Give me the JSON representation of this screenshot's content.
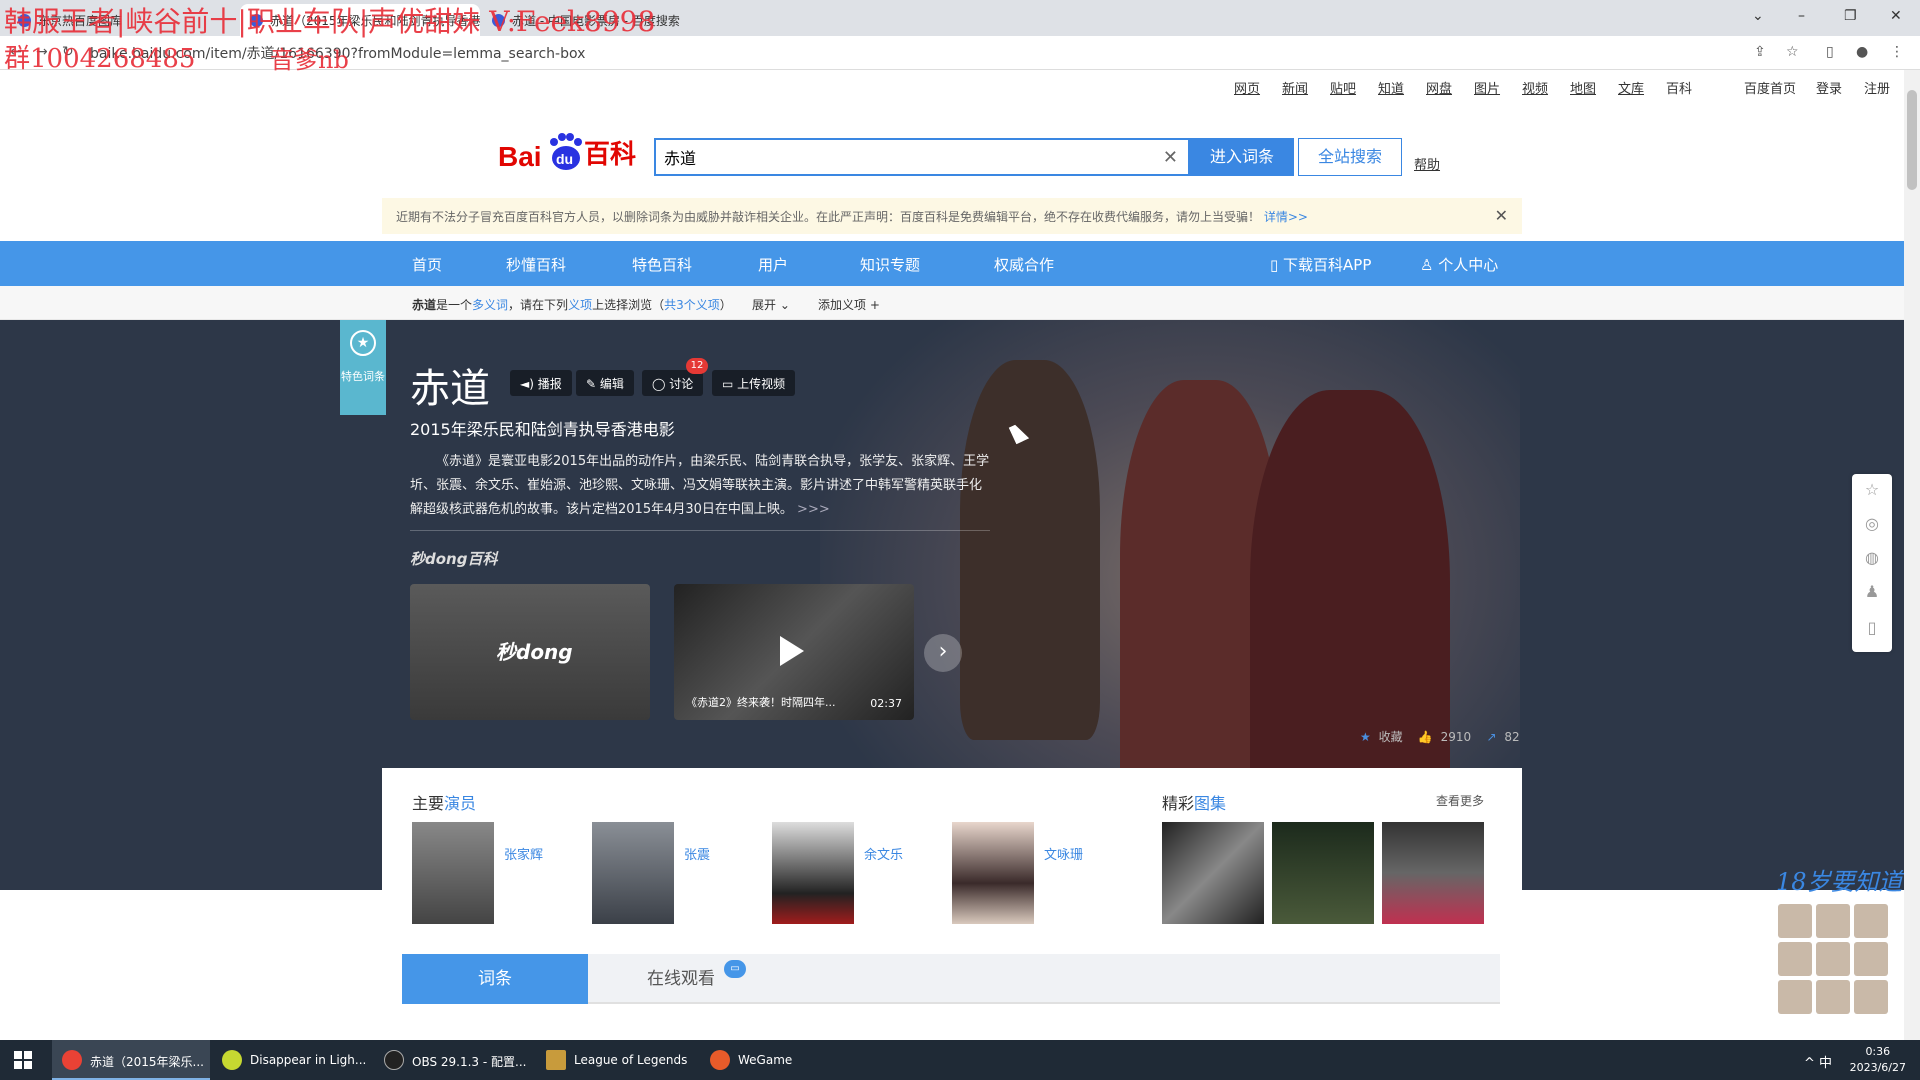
{
  "browser": {
    "tabs": [
      {
        "title": "东京热百度图库"
      },
      {
        "title": "赤道（2015年梁乐民和陆剑青执导香港电影）_百度百科"
      },
      {
        "title": "赤道 - 中国电影票房 - 百度搜索"
      }
    ],
    "url": "baike.baidu.com/item/赤道/16166390?fromModule=lemma_search-box",
    "window_controls": {
      "minimize": "–",
      "restore": "❐",
      "close": "✕",
      "menu": "⌄"
    }
  },
  "overlay": {
    "line1": "韩服王者|峡谷前十|职业车队|声优甜妹 V:Feek8998",
    "line2": "群1004268485",
    "line3": "音爹nb"
  },
  "toplinks": {
    "items": [
      "网页",
      "新闻",
      "贴吧",
      "知道",
      "网盘",
      "图片",
      "视频",
      "地图",
      "文库",
      "百科"
    ],
    "home": "百度首页",
    "login": "登录",
    "register": "注册"
  },
  "logo": {
    "text": "百科"
  },
  "search": {
    "value": "赤道",
    "enter_label": "进入词条",
    "all_label": "全站搜索",
    "help_label": "帮助"
  },
  "notice": {
    "text": "近期有不法分子冒充百度百科官方人员，以删除词条为由威胁并敲诈相关企业。在此严正声明：百度百科是免费编辑平台，绝不存在收费代编服务，请勿上当受骗！",
    "more": "详情>>"
  },
  "nav": {
    "items": [
      "首页",
      "秒懂百科",
      "特色百科",
      "用户",
      "知识专题",
      "权威合作"
    ],
    "download_app": "下载百科APP",
    "personal_center": "个人中心"
  },
  "subbar": {
    "lead": "赤道",
    "text_a": "是一个",
    "polysemy": "多义词",
    "text_b": "，请在下列",
    "meaning": "义项",
    "text_c": "上选择浏览（",
    "count": "共3个义项",
    "text_d": "）",
    "expand": "展开",
    "add": "添加义项"
  },
  "badge": {
    "label": "特色词条"
  },
  "entry": {
    "title": "赤道",
    "actions": {
      "broadcast": "播报",
      "edit": "编辑",
      "discuss": "讨论",
      "upload": "上传视频"
    },
    "discuss_count": "12",
    "subtitle": "2015年梁乐民和陆剑青执导香港电影",
    "summary": "《赤道》是寰亚电影2015年出品的动作片，由梁乐民、陆剑青联合执导，张学友、张家辉、王学圻、张震、余文乐、崔始源、池珍熙、文咏珊、冯文娟等联袂主演。影片讲述了中韩军警精英联手化解超级核武器危机的故事。该片定档2015年4月30日在中国上映。",
    "summary_more": ">>>"
  },
  "miaodong": {
    "logo": "秒dong百科",
    "video1_label": "秒dong",
    "video2_caption": "《赤道2》终来袭！时隔四年...",
    "video2_duration": "02:37"
  },
  "stats": {
    "collect": "收藏",
    "likes": "2910",
    "shares": "82"
  },
  "cast": {
    "title_a": "主要",
    "title_b": "演员",
    "actors": [
      "张家辉",
      "张震",
      "余文乐",
      "文咏珊"
    ]
  },
  "gallery": {
    "title_a": "精彩",
    "title_b": "图集",
    "more": "查看更多"
  },
  "content_tabs": {
    "entry": "词条",
    "watch": "在线观看"
  },
  "promo": {
    "age_text": "18岁要知道"
  },
  "taskbar": {
    "items": [
      {
        "label": "赤道（2015年梁乐...",
        "color": "#e94235"
      },
      {
        "label": "Disappear in Ligh...",
        "color": "#c6d831"
      },
      {
        "label": "OBS 29.1.3 - 配置...",
        "color": "#222222"
      },
      {
        "label": "League of Legends",
        "color": "#c89b3c"
      },
      {
        "label": "WeGame",
        "color": "#e85b2a"
      }
    ],
    "tray": "^ 中",
    "time": "0:36",
    "date": "2023/6/27"
  }
}
